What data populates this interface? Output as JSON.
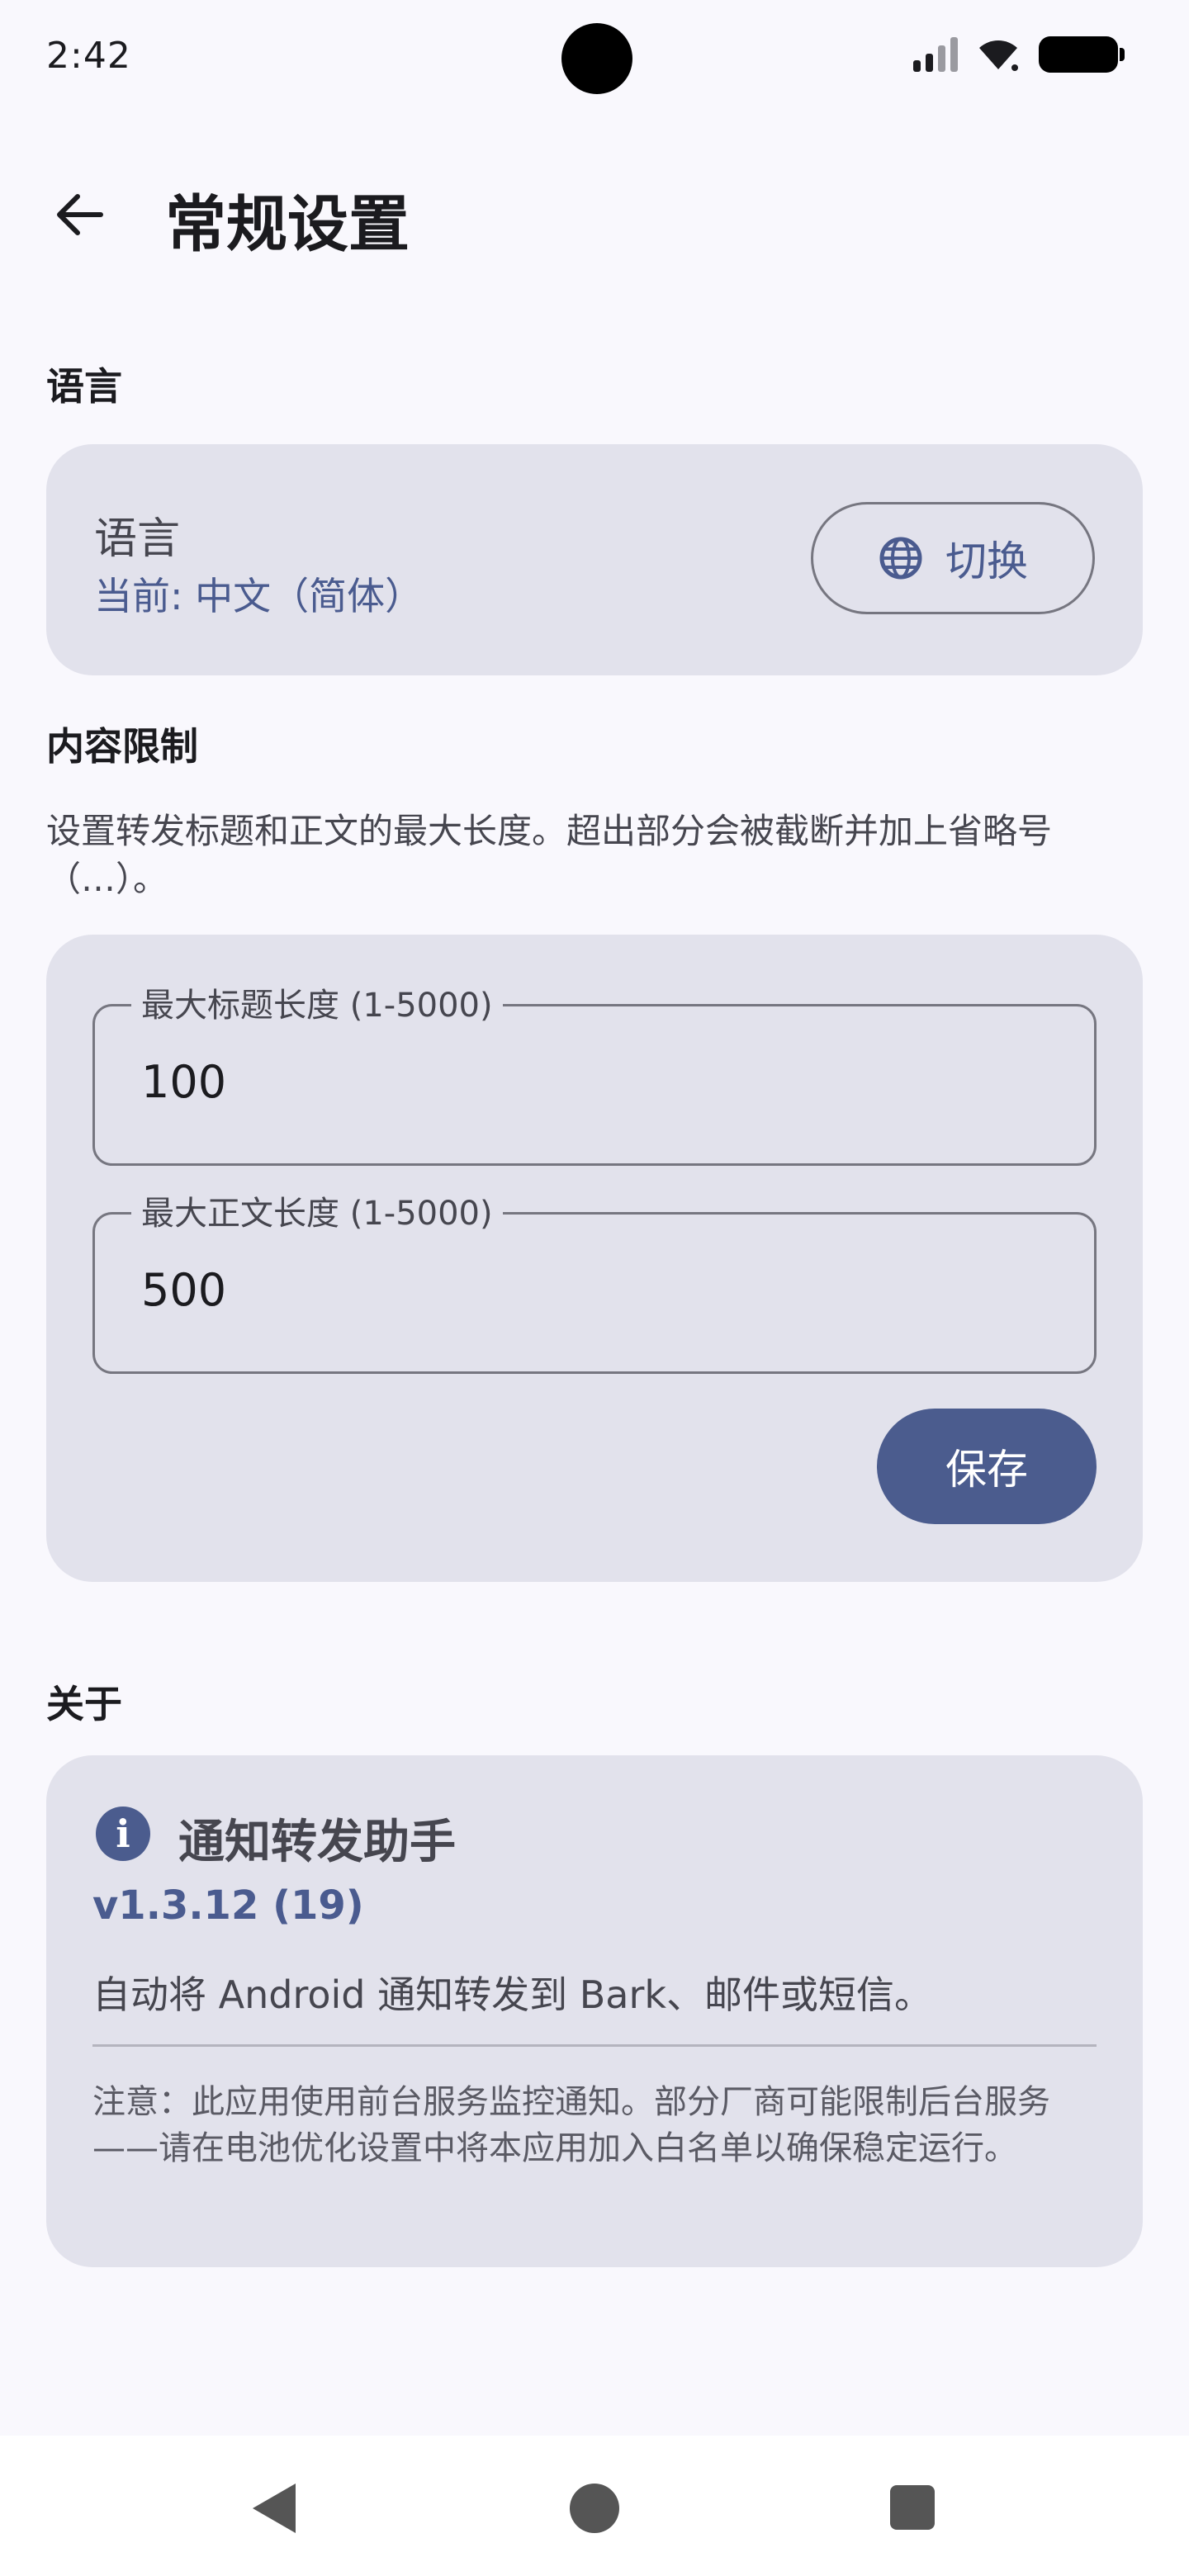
{
  "status_bar": {
    "time": "2:42"
  },
  "app_bar": {
    "title": "常规设置"
  },
  "language_section": {
    "heading": "语言",
    "label": "语言",
    "current": "当前: 中文（简体）",
    "switch_label": "切换"
  },
  "content_limit_section": {
    "heading": "内容限制",
    "description": "设置转发标题和正文的最大长度。超出部分会被截断并加上省略号（…）。",
    "title_field": {
      "label": "最大标题长度 (1-5000)",
      "value": "100"
    },
    "body_field": {
      "label": "最大正文长度 (1-5000)",
      "value": "500"
    },
    "save_label": "保存"
  },
  "about_section": {
    "heading": "关于",
    "app_name": "通知转发助手",
    "version": "v1.3.12 (19)",
    "description": "自动将 Android 通知转发到 Bark、邮件或短信。",
    "note": "注意：此应用使用前台服务监控通知。部分厂商可能限制后台服务——请在电池优化设置中将本应用加入白名单以确保稳定运行。"
  },
  "colors": {
    "accent": "#4b5c8e",
    "card": "#e2e2ec",
    "background": "#f9f8fd"
  },
  "icons": [
    "arrow-left-icon",
    "globe-icon",
    "info-icon",
    "wifi-icon",
    "signal-icon",
    "battery-icon"
  ]
}
